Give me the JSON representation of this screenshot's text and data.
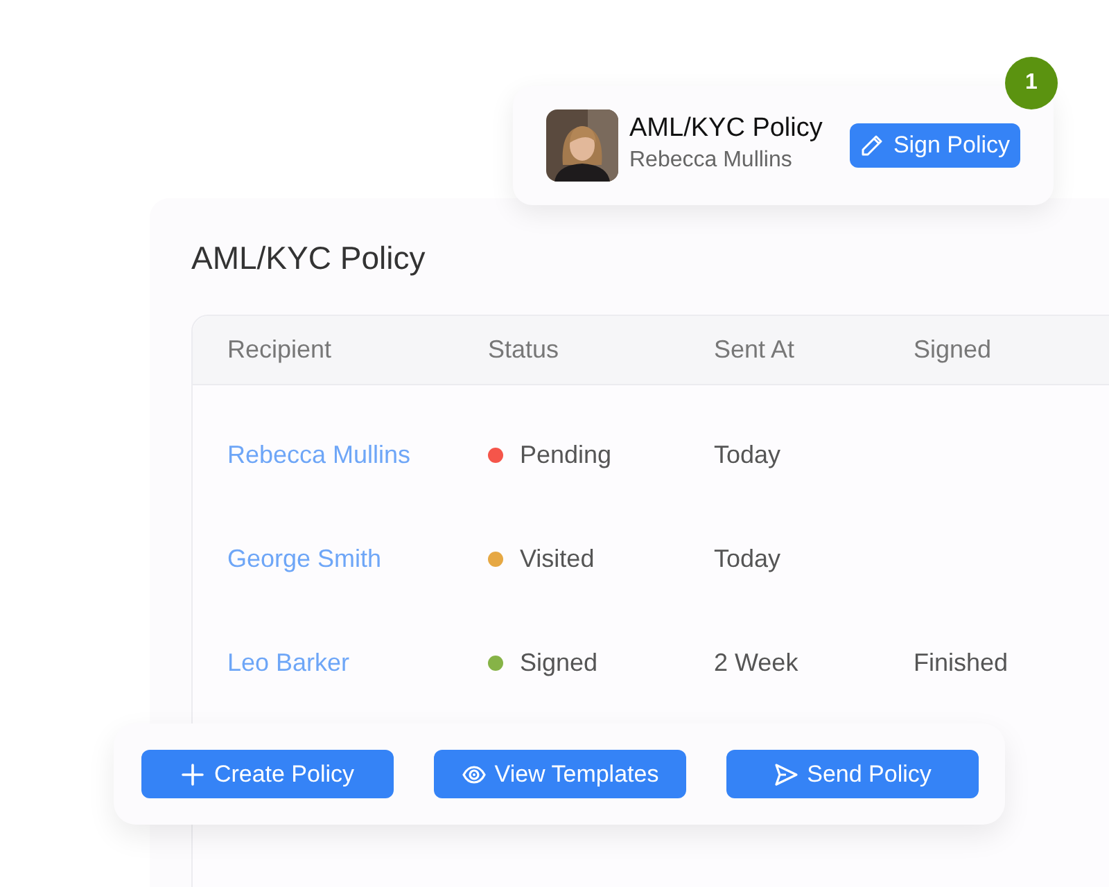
{
  "popup": {
    "title": "AML/KYC Policy",
    "subtitle": "Rebecca Mullins",
    "button": "Sign Policy",
    "badge": "1"
  },
  "panel": {
    "title": "AML/KYC Policy"
  },
  "table": {
    "columns": [
      "Recipient",
      "Status",
      "Sent At",
      "Signed"
    ],
    "rows": [
      {
        "recipient": "Rebecca Mullins",
        "status": "Pending",
        "color": "#f5554a",
        "sent_at": "Today"
      },
      {
        "recipient": "George Smith",
        "status": "Visited",
        "color": "#e6a843",
        "sent_at": "Today"
      },
      {
        "recipient": "Leo Barker",
        "status": "Signed",
        "color": "#86b347",
        "sent_at": "2 Week",
        "signed": "Finished"
      }
    ]
  },
  "actions": [
    {
      "label": "Create Policy",
      "kind": "plus"
    },
    {
      "label": "View Templates",
      "kind": "eye"
    },
    {
      "label": "Send Policy",
      "kind": "send"
    }
  ]
}
